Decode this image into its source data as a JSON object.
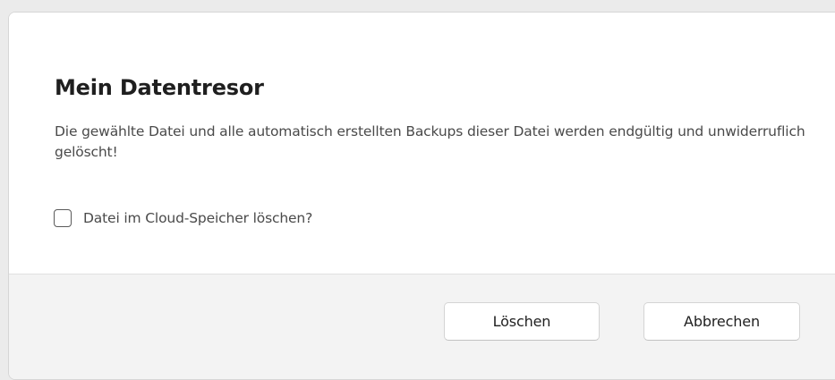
{
  "dialog": {
    "title": "Mein Datentresor",
    "message": "Die gewählte Datei und alle automatisch erstellten Backups dieser Datei werden endgültig und unwiderruflich gelöscht!",
    "checkbox": {
      "label": "Datei im Cloud-Speicher löschen?",
      "checked": false
    },
    "buttons": {
      "delete_label": "Löschen",
      "cancel_label": "Abbrechen"
    }
  }
}
